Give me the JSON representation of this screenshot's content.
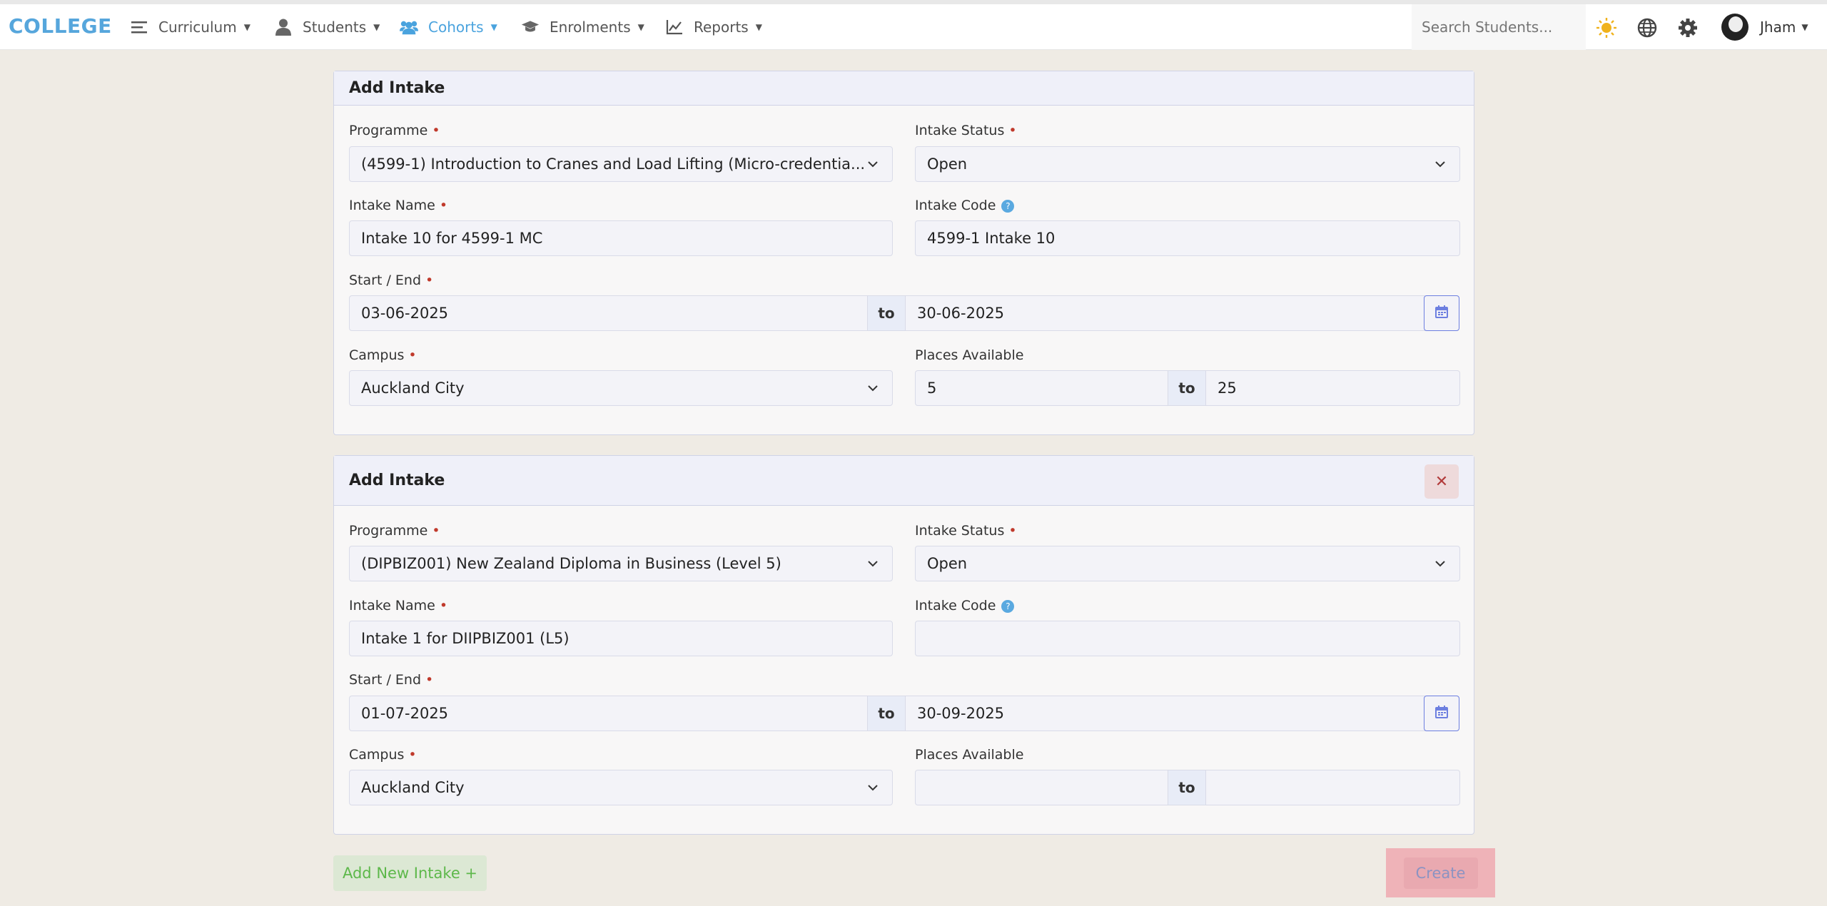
{
  "brand": "COLLEGE",
  "nav": [
    {
      "label": "Curriculum",
      "icon": "menu-lines-icon"
    },
    {
      "label": "Students",
      "icon": "person-icon"
    },
    {
      "label": "Cohorts",
      "icon": "group-icon"
    },
    {
      "label": "Enrolments",
      "icon": "graduation-cap-icon"
    },
    {
      "label": "Reports",
      "icon": "line-chart-icon"
    }
  ],
  "search": {
    "placeholder": "Search Students..."
  },
  "user": {
    "name": "Jham"
  },
  "colors": {
    "brand": "#56a6dc",
    "accent": "#4aa3de",
    "required": "#c0392b",
    "add": "#5db84a"
  },
  "intakes": [
    {
      "title": "Add Intake",
      "programme_label": "Programme",
      "programme_value": "(4599-1) Introduction to Cranes and Load Lifting (Micro-credentia...",
      "status_label": "Intake Status",
      "status_value": "Open",
      "name_label": "Intake Name",
      "name_value": "Intake 10 for 4599-1 MC",
      "code_label": "Intake Code",
      "code_value": "4599-1 Intake 10",
      "dates_label": "Start / End",
      "start_value": "03-06-2025",
      "to_label": "to",
      "end_value": "30-06-2025",
      "campus_label": "Campus",
      "campus_value": "Auckland City",
      "places_label": "Places Available",
      "places_min": "5",
      "places_max": "25"
    },
    {
      "title": "Add Intake",
      "programme_label": "Programme",
      "programme_value": "(DIPBIZ001) New Zealand Diploma in Business (Level 5)",
      "status_label": "Intake Status",
      "status_value": "Open",
      "name_label": "Intake Name",
      "name_value": "Intake 1 for DIIPBIZ001 (L5)",
      "code_label": "Intake Code",
      "code_value": "",
      "dates_label": "Start / End",
      "start_value": "01-07-2025",
      "to_label": "to",
      "end_value": "30-09-2025",
      "campus_label": "Campus",
      "campus_value": "Auckland City",
      "places_label": "Places Available",
      "places_min": "",
      "places_max": ""
    }
  ],
  "actions": {
    "add_new": "Add New Intake +",
    "create": "Create"
  }
}
